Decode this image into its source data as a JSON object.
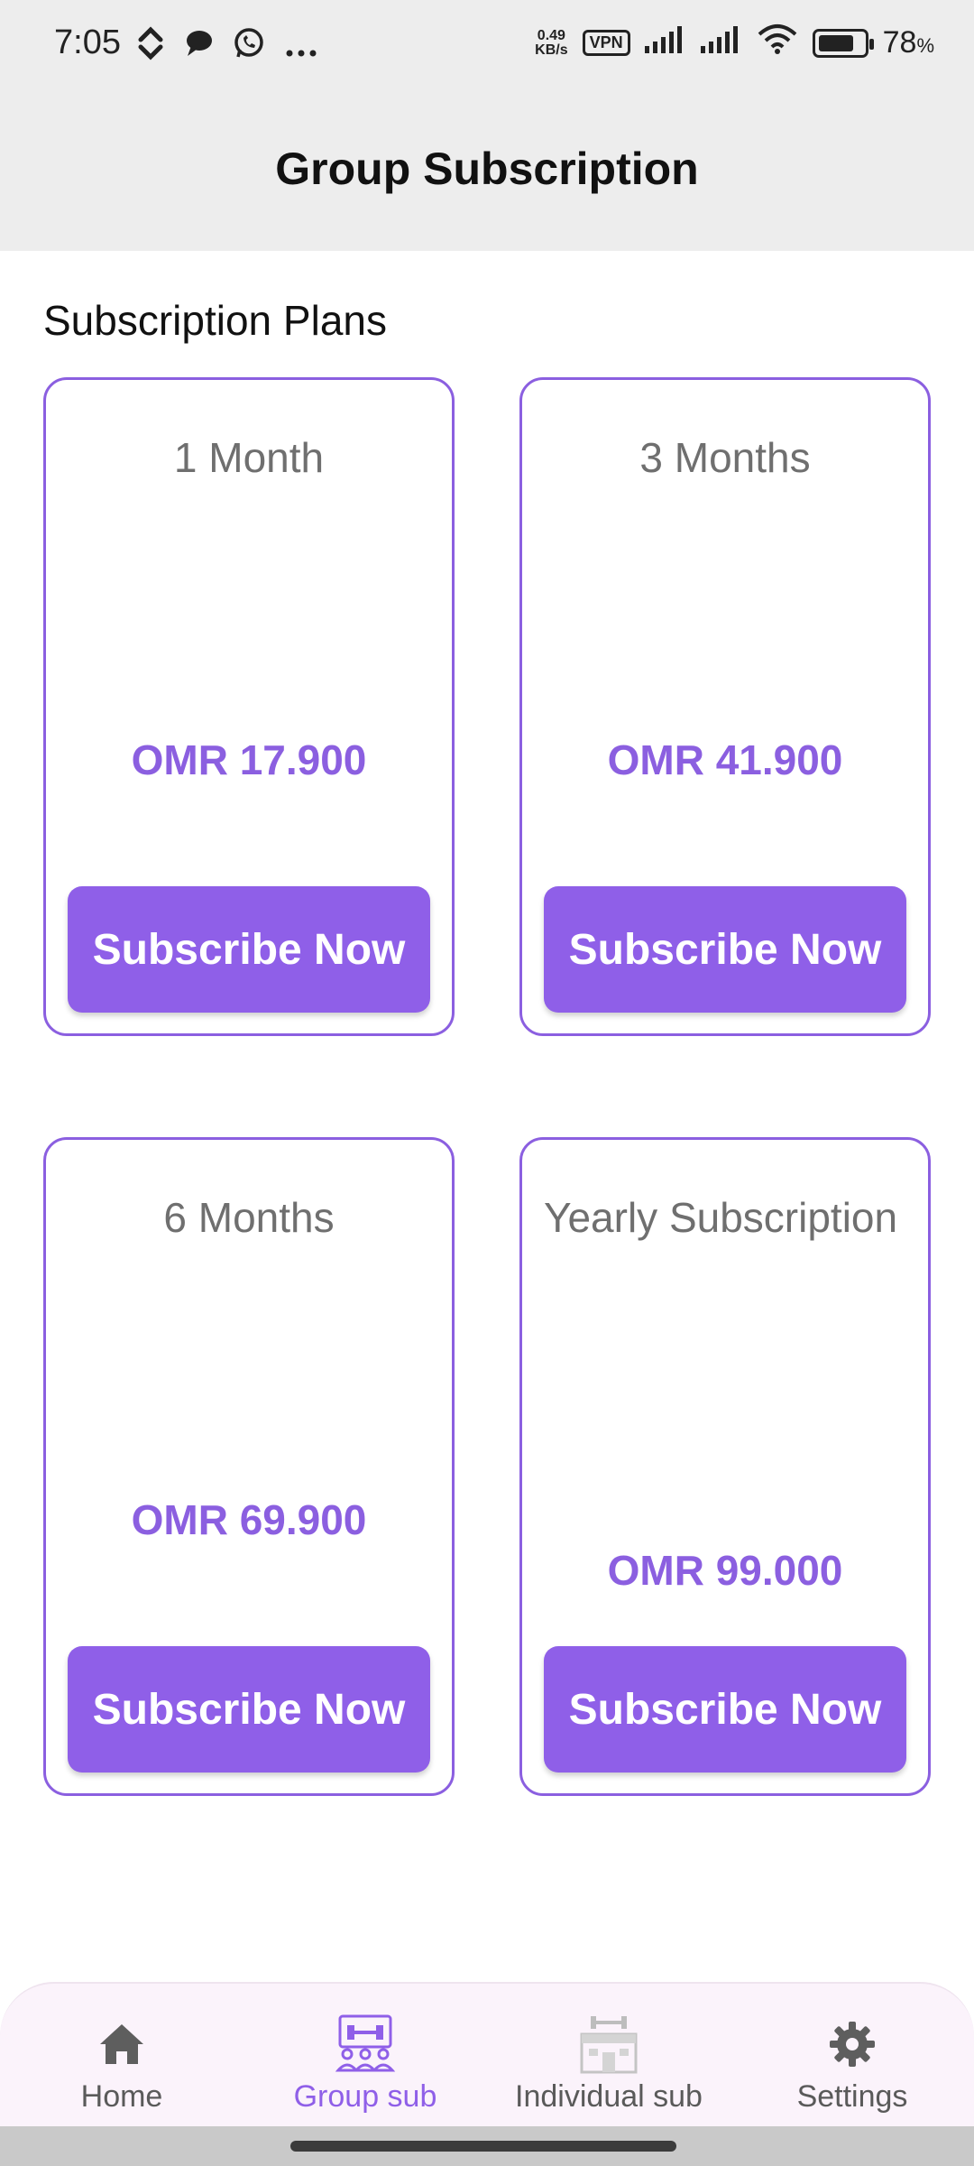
{
  "status_bar": {
    "time": "7:05",
    "left_icons": [
      "swap-icon",
      "chat-bubble-icon",
      "whatsapp-icon",
      "more-dots-icon"
    ],
    "net_speed_value": "0.49",
    "net_speed_unit": "KB/s",
    "vpn_label": "VPN",
    "battery_percent": "78",
    "battery_unit": "%"
  },
  "header": {
    "title": "Group Subscription"
  },
  "section": {
    "title": "Subscription Plans"
  },
  "plans": [
    {
      "name": "1 Month",
      "price": "OMR 17.900",
      "button": "Subscribe Now"
    },
    {
      "name": "3 Months",
      "price": "OMR 41.900",
      "button": "Subscribe Now"
    },
    {
      "name": "6 Months",
      "price": "OMR 69.900",
      "button": "Subscribe Now"
    },
    {
      "name": "Yearly Subscription",
      "price": "OMR 99.000",
      "button": "Subscribe Now"
    }
  ],
  "nav": {
    "items": [
      {
        "label": "Home",
        "icon": "home-icon",
        "active": false
      },
      {
        "label": "Group sub",
        "icon": "group-gym-icon",
        "active": true
      },
      {
        "label": "Individual sub",
        "icon": "gym-building-icon",
        "active": false
      },
      {
        "label": "Settings",
        "icon": "gear-icon",
        "active": false
      }
    ]
  },
  "colors": {
    "accent": "#8f5fe8",
    "card_border": "#8b5fe0",
    "header_bg": "#ededed",
    "nav_bg": "#fbf3fb",
    "muted_text": "#6f6f6f"
  }
}
